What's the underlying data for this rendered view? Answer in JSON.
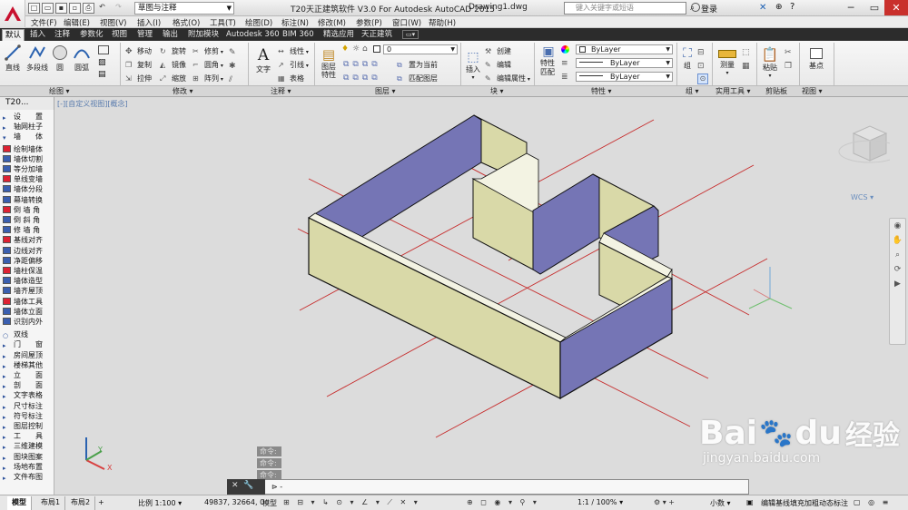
{
  "app": {
    "title": "T20天正建筑软件 V3.0 For Autodesk AutoCAD 2015",
    "document": "Drawing1.dwg",
    "workspace": "草图与注释",
    "search_placeholder": "键入关键字或短语",
    "login": "登录"
  },
  "menu": [
    "文件(F)",
    "编辑(E)",
    "视图(V)",
    "插入(I)",
    "格式(O)",
    "工具(T)",
    "绘图(D)",
    "标注(N)",
    "修改(M)",
    "参数(P)",
    "窗口(W)",
    "帮助(H)"
  ],
  "ribbon_tabs": [
    "默认",
    "插入",
    "注释",
    "参数化",
    "视图",
    "管理",
    "输出",
    "附加模块",
    "Autodesk 360",
    "BIM 360",
    "精选应用",
    "天正建筑"
  ],
  "panels": {
    "draw": {
      "title": "绘图",
      "tools": [
        "直线",
        "多段线",
        "圆",
        "圆弧"
      ]
    },
    "modify": {
      "title": "修改",
      "tools": [
        "移动",
        "旋转",
        "修剪",
        "复制",
        "镜像",
        "圆角",
        "拉伸",
        "缩放",
        "阵列"
      ]
    },
    "annotation": {
      "title": "注释",
      "tools": [
        "文字",
        "线性",
        "引线",
        "表格"
      ]
    },
    "layers": {
      "title": "图层",
      "tools": [
        "图层特性",
        "置为当前",
        "匹配图层"
      ],
      "current_layer": "0"
    },
    "block": {
      "title": "块",
      "tools": [
        "插入",
        "创建",
        "编辑",
        "编辑属性"
      ]
    },
    "properties": {
      "title": "特性",
      "tools": [
        "特性匹配"
      ],
      "color": "ByLayer",
      "linetype": "ByLayer",
      "lineweight": "ByLayer"
    },
    "groups": {
      "title": "组",
      "tools": [
        "组"
      ]
    },
    "utilities": {
      "title": "实用工具",
      "tools": [
        "测量"
      ]
    },
    "clipboard": {
      "title": "剪贴板",
      "tools": [
        "粘贴"
      ]
    },
    "view": {
      "title": "视图",
      "tools": [
        "基点"
      ]
    }
  },
  "file_tab": "T20...",
  "viewport_label": "[-][自定义视图][概念]",
  "viewcube": {
    "label": "WCS"
  },
  "palette": {
    "items": [
      "设　　置",
      "轴网柱子",
      "墙　　体",
      "绘制墙体",
      "墙体切割",
      "等分加墙",
      "单线变墙",
      "墙体分段",
      "幕墙转换",
      "倒 墙 角",
      "倒 斜 角",
      "修 墙 角",
      "基线对齐",
      "边线对齐",
      "净距偏移",
      "墙柱保温",
      "墙体造型",
      "墙齐屋顶",
      "墙体工具",
      "墙体立面",
      "识别内外",
      "双线",
      "门　　窗",
      "房间屋顶",
      "楼梯其他",
      "立　　面",
      "剖　　面",
      "文字表格",
      "尺寸标注",
      "符号标注",
      "图层控制",
      "工　　具",
      "三维建模",
      "图块图案",
      "场地布置",
      "文件布图"
    ]
  },
  "command": {
    "history": [
      "命令:",
      "命令:",
      "命令:"
    ],
    "prompt": "命令:"
  },
  "layout_tabs": [
    "模型",
    "布局1",
    "布局2"
  ],
  "status": {
    "scale": "比例 1:100",
    "coords": "49837, 32664, 0",
    "space": "模型",
    "zoom": "1:1 / 100%",
    "units": "小数",
    "message": "编辑基线填充加粗动态标注"
  },
  "axis": {
    "x": "X",
    "y": "Y"
  },
  "watermark": {
    "brand": "Bai",
    "brand2": "经验",
    "url": "jingyan.baidu.com"
  },
  "colors": {
    "wall_face": "#d9d9a8",
    "wall_inner": "#7575b5",
    "wall_top": "#f3f3e3",
    "grid_line": "#cc2a2a",
    "ribbon_tab_bg": "#2c2c2c",
    "viewport_bg": "#dcdcdc"
  }
}
